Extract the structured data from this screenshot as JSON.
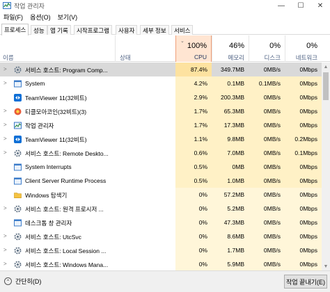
{
  "window": {
    "title": "작업 관리자",
    "minimize": "—",
    "maximize": "☐",
    "close": "✕"
  },
  "menu": [
    "파일(F)",
    "옵션(O)",
    "보기(V)"
  ],
  "tabs": [
    "프로세스",
    "성능",
    "앱 기록",
    "시작프로그램",
    "사용자",
    "세부 정보",
    "서비스"
  ],
  "columns": {
    "name": "이름",
    "status": "상태",
    "cpu": {
      "pct": "100%",
      "label": "CPU"
    },
    "memory": {
      "pct": "46%",
      "label": "메모리"
    },
    "disk": {
      "pct": "0%",
      "label": "디스크"
    },
    "network": {
      "pct": "0%",
      "label": "네트워크"
    }
  },
  "processes": [
    {
      "name": "서비스 호스트: Program Comp...",
      "expandable": true,
      "icon": "gear-icon",
      "cpu": "87.4%",
      "memory": "349.7MB",
      "disk": "0MB/s",
      "network": "0Mbps",
      "selected": true,
      "heat": 3
    },
    {
      "name": "System",
      "expandable": true,
      "icon": "window-icon",
      "cpu": "4.2%",
      "memory": "0.1MB",
      "disk": "0.1MB/s",
      "network": "0Mbps",
      "selected": false,
      "heat": 1
    },
    {
      "name": "TeamViewer 11(32비트)",
      "expandable": false,
      "icon": "teamviewer-icon",
      "cpu": "2.9%",
      "memory": "200.3MB",
      "disk": "0MB/s",
      "network": "0Mbps",
      "selected": false,
      "heat": 1
    },
    {
      "name": "티클모아코인(32비트)(3)",
      "expandable": true,
      "icon": "app-icon",
      "cpu": "1.7%",
      "memory": "65.3MB",
      "disk": "0MB/s",
      "network": "0Mbps",
      "selected": false,
      "heat": 1
    },
    {
      "name": "작업 관리자",
      "expandable": true,
      "icon": "task-manager-icon",
      "cpu": "1.7%",
      "memory": "17.3MB",
      "disk": "0MB/s",
      "network": "0Mbps",
      "selected": false,
      "heat": 1
    },
    {
      "name": "TeamViewer 11(32비트)",
      "expandable": true,
      "icon": "teamviewer-icon",
      "cpu": "1.1%",
      "memory": "9.8MB",
      "disk": "0MB/s",
      "network": "0.2Mbps",
      "selected": false,
      "heat": 1
    },
    {
      "name": "서비스 호스트: Remote Deskto...",
      "expandable": true,
      "icon": "gear-icon",
      "cpu": "0.6%",
      "memory": "7.0MB",
      "disk": "0MB/s",
      "network": "0.1Mbps",
      "selected": false,
      "heat": 1
    },
    {
      "name": "System Interrupts",
      "expandable": false,
      "icon": "window-icon",
      "cpu": "0.5%",
      "memory": "0MB",
      "disk": "0MB/s",
      "network": "0Mbps",
      "selected": false,
      "heat": 1
    },
    {
      "name": "Client Server Runtime Process",
      "expandable": false,
      "icon": "window-icon",
      "cpu": "0.5%",
      "memory": "1.0MB",
      "disk": "0MB/s",
      "network": "0Mbps",
      "selected": false,
      "heat": 1
    },
    {
      "name": "Windows 탐색기",
      "expandable": false,
      "icon": "folder-icon",
      "cpu": "0%",
      "memory": "57.2MB",
      "disk": "0MB/s",
      "network": "0Mbps",
      "selected": false,
      "heat": 0
    },
    {
      "name": "서비스 호스트: 원격 프로시저 ...",
      "expandable": true,
      "icon": "gear-icon",
      "cpu": "0%",
      "memory": "5.2MB",
      "disk": "0MB/s",
      "network": "0Mbps",
      "selected": false,
      "heat": 0
    },
    {
      "name": "데스크톱 창 관리자",
      "expandable": false,
      "icon": "window-icon",
      "cpu": "0%",
      "memory": "47.3MB",
      "disk": "0MB/s",
      "network": "0Mbps",
      "selected": false,
      "heat": 0
    },
    {
      "name": "서비스 호스트: UtcSvc",
      "expandable": true,
      "icon": "gear-icon",
      "cpu": "0%",
      "memory": "8.6MB",
      "disk": "0MB/s",
      "network": "0Mbps",
      "selected": false,
      "heat": 0
    },
    {
      "name": "서비스 호스트: Local Session ...",
      "expandable": true,
      "icon": "gear-icon",
      "cpu": "0%",
      "memory": "1.7MB",
      "disk": "0MB/s",
      "network": "0Mbps",
      "selected": false,
      "heat": 0
    },
    {
      "name": "서비스 호스트: Windows Mana...",
      "expandable": true,
      "icon": "gear-icon",
      "cpu": "0%",
      "memory": "5.9MB",
      "disk": "0MB/s",
      "network": "0Mbps",
      "selected": false,
      "heat": 0
    }
  ],
  "footer": {
    "fewer_details": "간단히(D)",
    "end_task": "작업 끝내기(E)"
  },
  "colors": {
    "heat_0": "#fff6d9",
    "heat_1": "#fff1c6",
    "heat_3": "#fde2a0",
    "selected_row": "#d9d9d9",
    "cpu_header": "#ffe5d2"
  }
}
